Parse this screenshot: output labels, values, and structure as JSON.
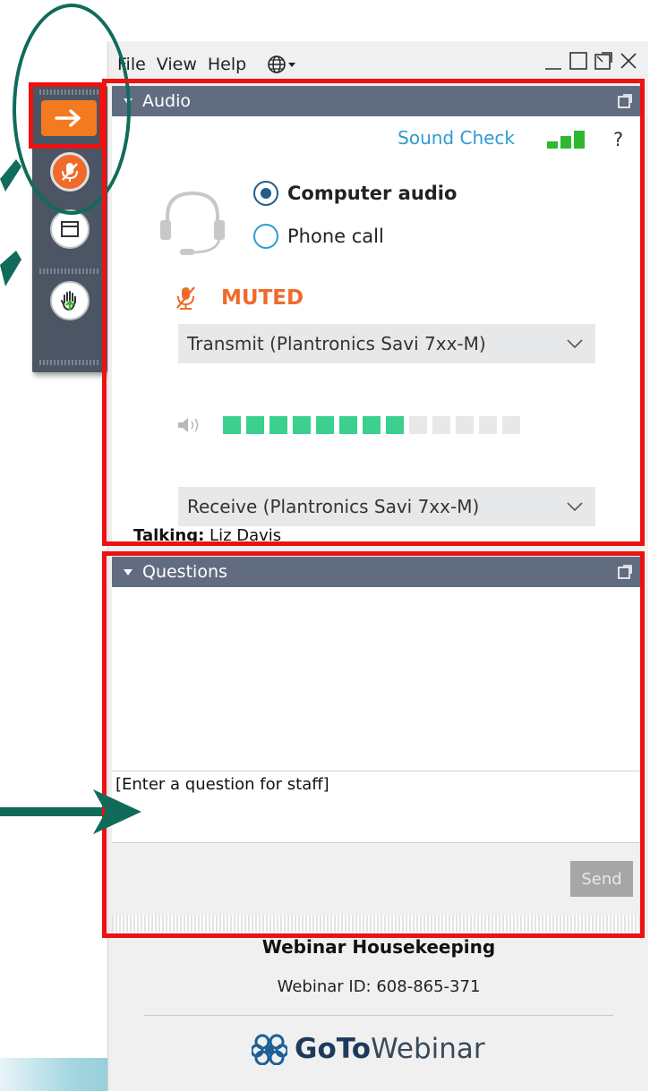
{
  "menu": {
    "items": [
      "File",
      "View",
      "Help"
    ],
    "language_icon": "globe-icon"
  },
  "window_controls": [
    "minimize-icon",
    "maximize-icon",
    "popout-icon",
    "close-icon"
  ],
  "sidebar": {
    "buttons": [
      "collapse-arrow-icon",
      "mic-muted-icon",
      "window-icon",
      "raise-hand-icon"
    ]
  },
  "audio": {
    "title": "Audio",
    "sound_check": "Sound Check",
    "help": "?",
    "options": [
      {
        "label": "Computer audio",
        "selected": true
      },
      {
        "label": "Phone call",
        "selected": false
      }
    ],
    "status": "MUTED",
    "transmit": "Transmit (Plantronics Savi 7xx-M)",
    "receive": "Receive (Plantronics Savi 7xx-M)",
    "meter": {
      "segments": 13,
      "active": 8
    },
    "talking_label": "Talking:",
    "talking_name": "Liz Davis"
  },
  "questions": {
    "title": "Questions",
    "placeholder": "[Enter a question for staff]",
    "send": "Send"
  },
  "footer": {
    "title": "Webinar Housekeeping",
    "webinar_id": "Webinar ID: 608-865-371",
    "brand_bold": "GoTo",
    "brand_light": "Webinar"
  },
  "colors": {
    "accent_orange": "#f06a2c",
    "link_blue": "#2e9bd3",
    "panel_header": "#616c80",
    "annotation_red": "#ee1111",
    "annotation_green": "#106b5a",
    "meter_green": "#3ccf8e"
  }
}
